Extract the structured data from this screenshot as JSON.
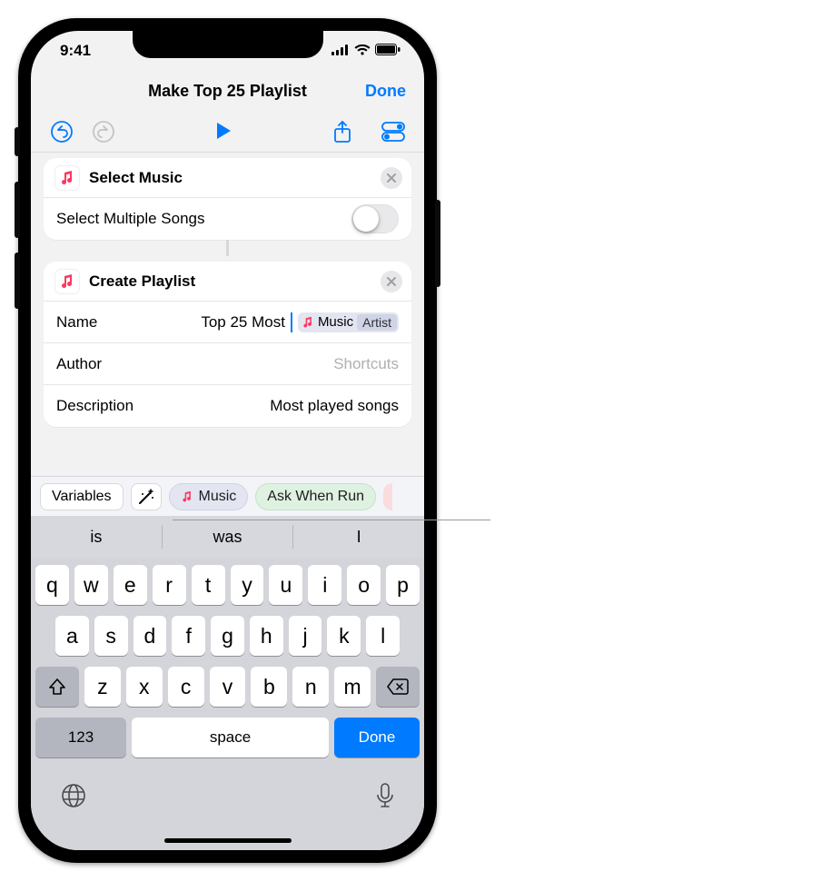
{
  "status": {
    "time": "9:41"
  },
  "nav": {
    "title": "Make Top 25 Playlist",
    "done": "Done"
  },
  "actions": {
    "selectMusic": {
      "title": "Select Music",
      "row": {
        "label": "Select Multiple Songs"
      }
    },
    "createPlaylist": {
      "title": "Create Playlist",
      "name": {
        "label": "Name",
        "value": "Top 25 Most",
        "tokenMain": "Music",
        "tokenTag": "Artist"
      },
      "author": {
        "label": "Author",
        "placeholder": "Shortcuts"
      },
      "description": {
        "label": "Description",
        "value": "Most played songs"
      }
    }
  },
  "varbar": {
    "variables": "Variables",
    "music": "Music",
    "ask": "Ask When Run"
  },
  "predictions": [
    "is",
    "was",
    "I"
  ],
  "keyboard": {
    "row1": [
      "q",
      "w",
      "e",
      "r",
      "t",
      "y",
      "u",
      "i",
      "o",
      "p"
    ],
    "row2": [
      "a",
      "s",
      "d",
      "f",
      "g",
      "h",
      "j",
      "k",
      "l"
    ],
    "row3": [
      "z",
      "x",
      "c",
      "v",
      "b",
      "n",
      "m"
    ],
    "numbers": "123",
    "space": "space",
    "done": "Done"
  }
}
